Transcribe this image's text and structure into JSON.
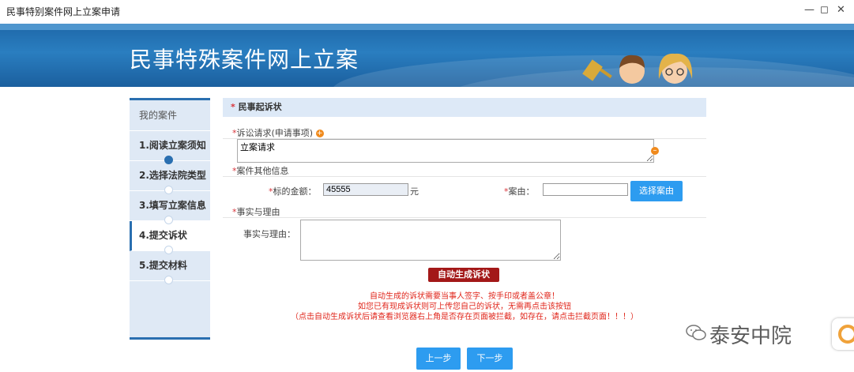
{
  "window": {
    "title": "民事特别案件网上立案申请"
  },
  "banner": {
    "title": "民事特殊案件网上立案"
  },
  "sidebar": {
    "header": "我的案件",
    "items": [
      {
        "label": "1.阅读立案须知"
      },
      {
        "label": "2.选择法院类型"
      },
      {
        "label": "3.填写立案信息"
      },
      {
        "label": "4.提交诉状"
      },
      {
        "label": "5.提交材料"
      }
    ]
  },
  "form": {
    "section_title": "民事起诉状",
    "claims": {
      "label": "诉讼请求(申请事项)",
      "value": "立案请求"
    },
    "other_info": {
      "label": "案件其他信息"
    },
    "amount": {
      "label": "标的金额：",
      "value": "45555",
      "unit": "元"
    },
    "cause": {
      "label": "案由：",
      "value": "",
      "button": "选择案由"
    },
    "facts": {
      "section_label": "事实与理由",
      "field_label": "事实与理由：",
      "value": ""
    },
    "generate_button": "自动生成诉状",
    "notes": [
      "自动生成的诉状需要当事人签字、按手印或者盖公章！",
      "如您已有现成诉状则可上传您自己的诉状，无需再点击该按钮",
      "（点击自动生成诉状后请查看浏览器右上角是否存在页面被拦截，如存在，请点击拦截页面！！！）"
    ],
    "prev_button": "上一步",
    "next_button": "下一步"
  },
  "watermark": {
    "text": "泰安中院"
  },
  "colors": {
    "accent": "#2a6fb0",
    "button_blue": "#2d9cf0",
    "button_red": "#a31818",
    "note_red": "#e0261b"
  }
}
